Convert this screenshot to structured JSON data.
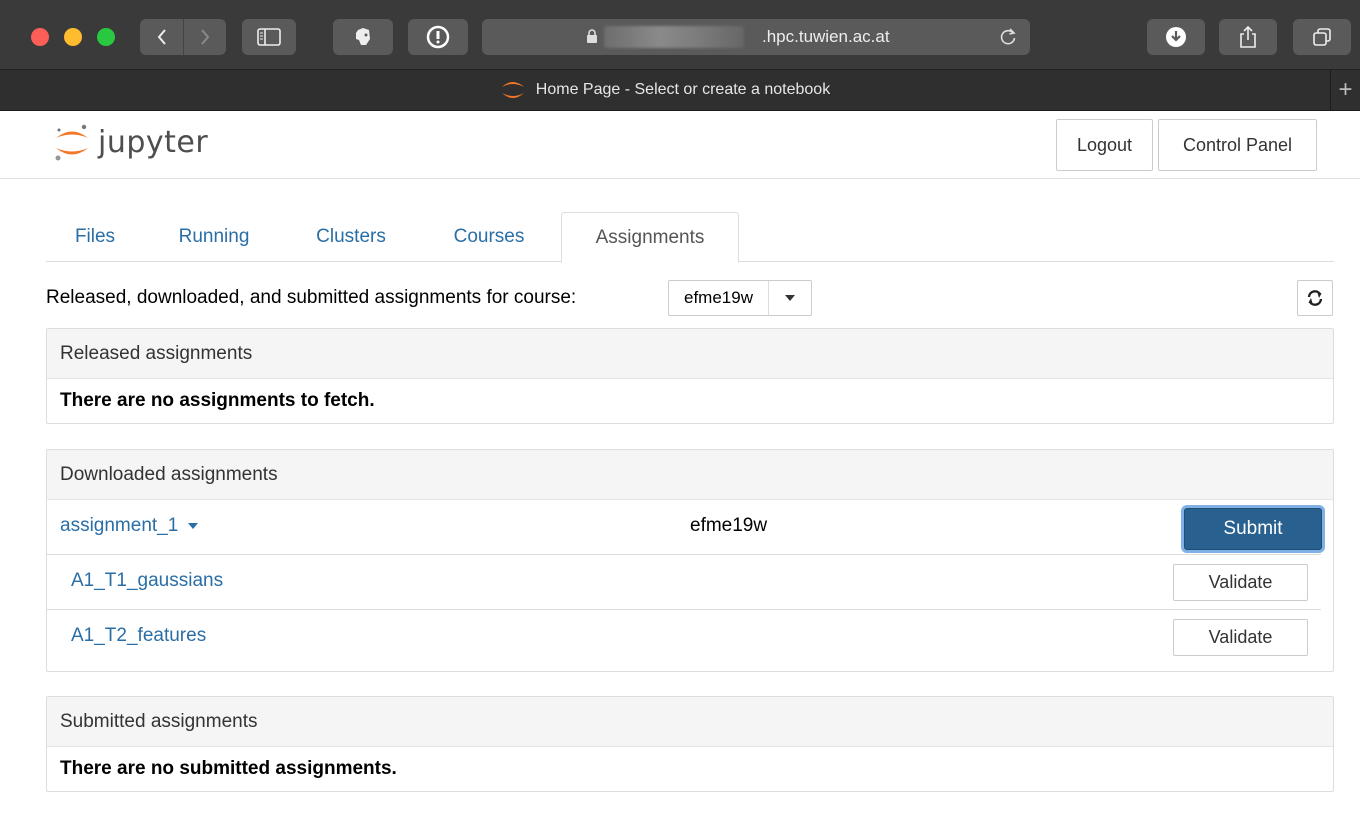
{
  "browser": {
    "url_suffix": ".hpc.tuwien.ac.at",
    "tab_title": "Home Page - Select or create a notebook",
    "plus_label": "+"
  },
  "header": {
    "logo_text": "jupyter",
    "logout_label": "Logout",
    "control_panel_label": "Control Panel"
  },
  "tabs": [
    {
      "label": "Files"
    },
    {
      "label": "Running"
    },
    {
      "label": "Clusters"
    },
    {
      "label": "Courses"
    },
    {
      "label": "Assignments"
    }
  ],
  "course_selector": {
    "label": "Released, downloaded, and submitted assignments for course:",
    "selected": "efme19w"
  },
  "released": {
    "title": "Released assignments",
    "empty_text": "There are no assignments to fetch."
  },
  "downloaded": {
    "title": "Downloaded assignments",
    "assignment": {
      "name": "assignment_1",
      "course": "efme19w",
      "submit_label": "Submit"
    },
    "notebooks": [
      {
        "name": "A1_T1_gaussians",
        "validate_label": "Validate"
      },
      {
        "name": "A1_T2_features",
        "validate_label": "Validate"
      }
    ]
  },
  "submitted": {
    "title": "Submitted assignments",
    "empty_text": "There are no submitted assignments."
  },
  "colors": {
    "link": "#2a6ea6",
    "primary": "#286090",
    "jupyter_orange": "#f37726"
  }
}
